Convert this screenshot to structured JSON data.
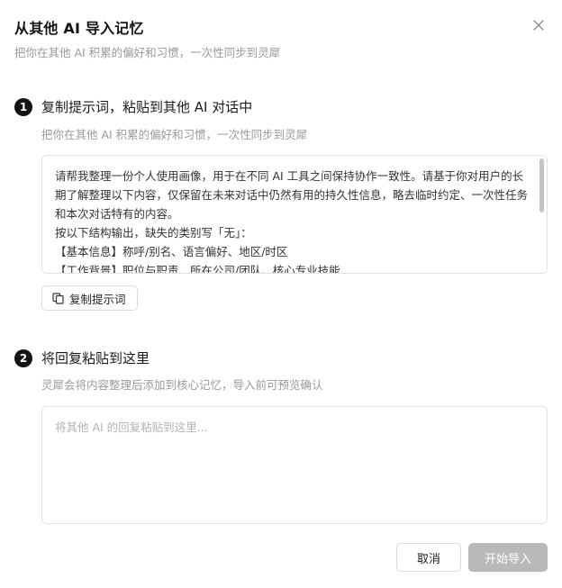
{
  "dialog": {
    "title": "从其他 AI 导入记忆",
    "subtitle": "把你在其他 AI 积累的偏好和习惯，一次性同步到灵犀",
    "close_icon": "close-icon"
  },
  "step1": {
    "number": "1",
    "title": "复制提示词，粘贴到其他 AI 对话中",
    "description": "把你在其他 AI 积累的偏好和习惯，一次性同步到灵犀",
    "prompt_text": "请帮我整理一份个人使用画像，用于在不同 AI 工具之间保持协作一致性。请基于你对用户的长期了解整理以下内容，仅保留在未来对话中仍然有用的持久性信息，略去临时约定、一次性任务和本次对话特有的内容。\n按以下结构输出，缺失的类别写「无」：\n【基本信息】称呼/别名、语言偏好、地区/时区\n【工作背景】职位与职责、所在公司/团队、核心专业技能",
    "copy_button_label": "复制提示词",
    "copy_icon": "copy-icon"
  },
  "step2": {
    "number": "2",
    "title": "将回复粘贴到这里",
    "description": "灵犀会将内容整理后添加到核心记忆，导入前可预览确认",
    "input_value": "",
    "input_placeholder": "将其他 AI 的回复粘贴到这里..."
  },
  "footer": {
    "cancel_label": "取消",
    "import_label": "开始导入"
  },
  "colors": {
    "step_badge": "#141414",
    "disabled_button": "#b9b9b9",
    "muted_text": "#9a9a9a",
    "border": "#e2e2e2"
  }
}
